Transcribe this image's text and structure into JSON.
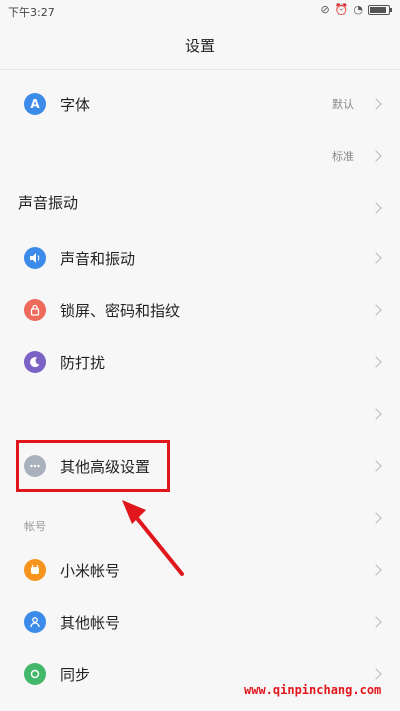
{
  "status": {
    "time": "下午3:27"
  },
  "title": "设置",
  "rows": {
    "font": {
      "label": "字体",
      "value": "默认",
      "icon": "font-icon",
      "icon_text": "A"
    },
    "text_size": {
      "value": "标准"
    },
    "sound_header": {
      "label": "声音振动"
    },
    "sound": {
      "label": "声音和振动",
      "icon": "speaker-icon"
    },
    "lock": {
      "label": "锁屏、密码和指纹",
      "icon": "lock-icon"
    },
    "dnd": {
      "label": "防打扰",
      "icon": "moon-icon"
    },
    "other_adv": {
      "label": "其他高级设置",
      "icon": "more-icon"
    },
    "mi_account": {
      "label": "小米帐号",
      "icon": "mi-account-icon"
    },
    "other_account": {
      "label": "其他帐号",
      "icon": "account-icon"
    },
    "sync": {
      "label": "同步",
      "icon": "sync-icon"
    }
  },
  "sections": {
    "accounts": "帐号"
  },
  "watermark": "www.qinpinchang.com",
  "colors": {
    "blue": "#3d8be8",
    "red": "#ee6a5a",
    "purple": "#7a63c4",
    "gray": "#a9b2bc",
    "orange": "#f7941d",
    "green": "#43b76a",
    "highlight": "#e0161c"
  }
}
